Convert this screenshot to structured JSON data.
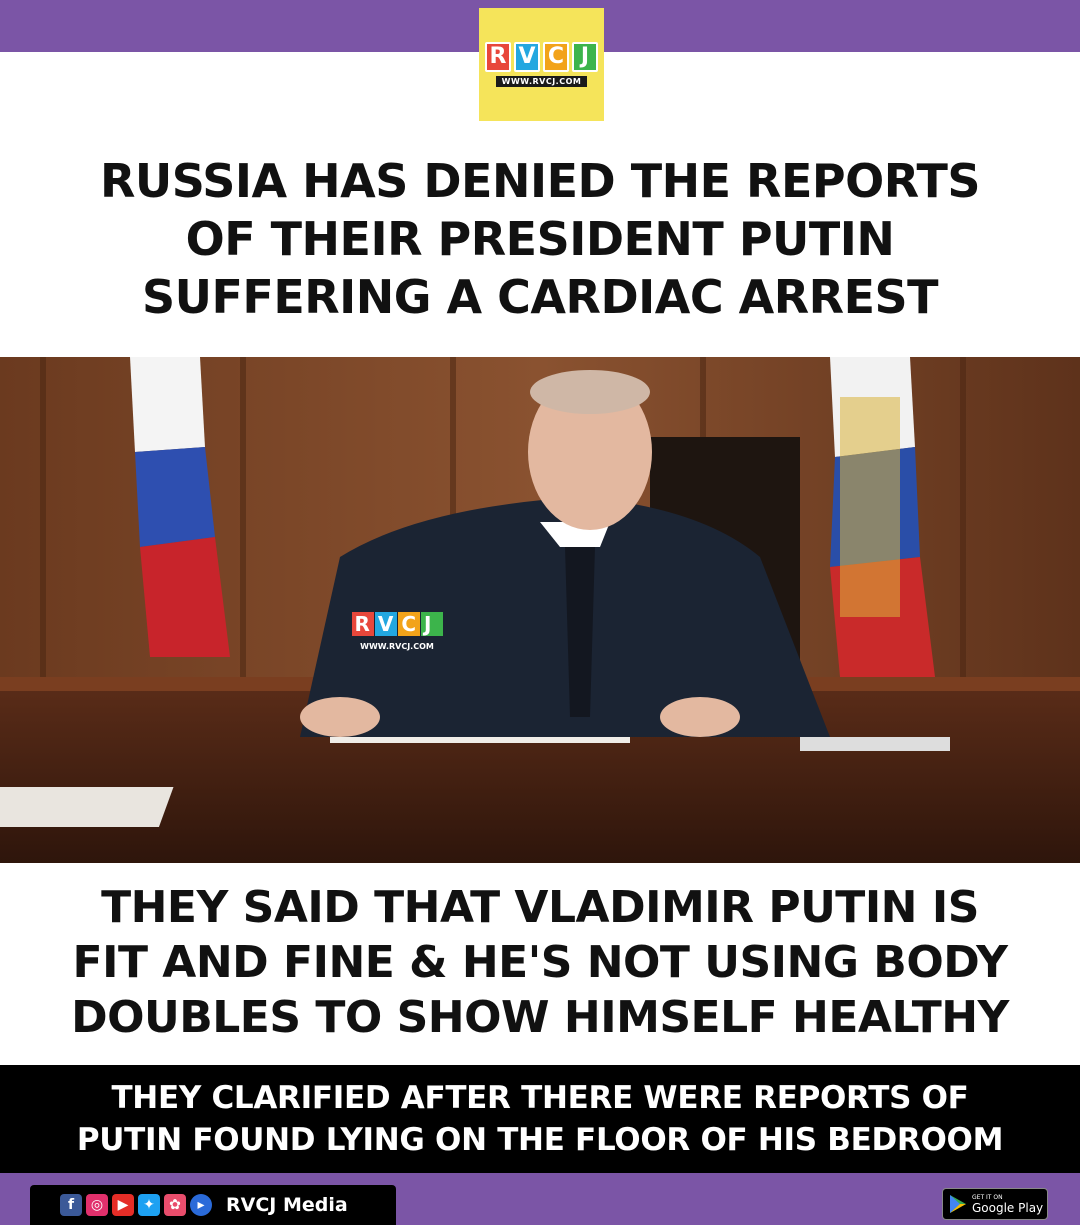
{
  "logo": {
    "letters": [
      "R",
      "V",
      "C",
      "J"
    ],
    "url": "WWW.RVCJ.COM",
    "colors": [
      "#e8473b",
      "#23a7e0",
      "#f2a31a",
      "#3cb44b"
    ]
  },
  "headline": {
    "lines": [
      "RUSSIA HAS DENIED THE REPORTS",
      "OF THEIR PRESIDENT PUTIN",
      "SUFFERING A CARDIAC ARREST"
    ]
  },
  "photo": {
    "watermark_letters": "RVCJ",
    "watermark_url": "WWW.RVCJ.COM"
  },
  "body": {
    "lines": [
      "THEY SAID THAT VLADIMIR PUTIN IS",
      "FIT AND FINE & HE'S NOT USING BODY",
      "DOUBLES TO SHOW HIMSELF HEALTHY"
    ]
  },
  "band": {
    "lines": [
      "THEY CLARIFIED AFTER THERE WERE REPORTS OF",
      "PUTIN FOUND LYING ON THE FLOOR OF HIS BEDROOM"
    ]
  },
  "footer": {
    "brand": "RVCJ Media",
    "social_icons": [
      "facebook-icon",
      "instagram-icon",
      "youtube-icon",
      "twitter-icon",
      "moj-icon",
      "play-icon"
    ],
    "gplay_small": "GET IT ON",
    "gplay_big": "Google Play"
  },
  "colors": {
    "purple": "#7b55a6",
    "yellow": "#f5e45a",
    "black": "#000000"
  }
}
